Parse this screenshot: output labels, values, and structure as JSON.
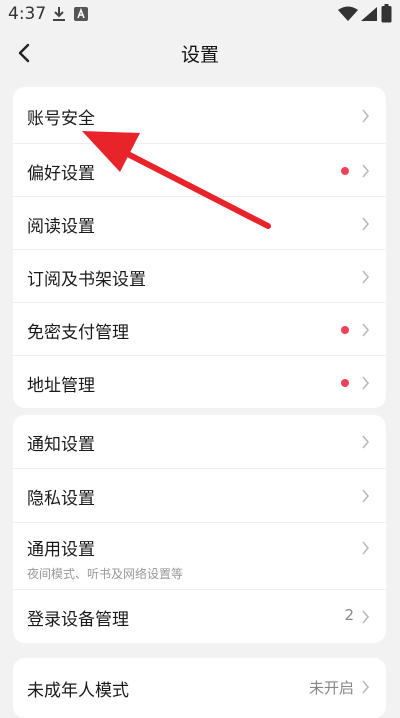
{
  "status_bar": {
    "time": "4:37",
    "icons": [
      "download-icon",
      "a-icon",
      "wifi-icon",
      "signal-icon",
      "battery-icon"
    ]
  },
  "nav": {
    "title": "设置",
    "back_icon": "back-arrow-icon"
  },
  "group1": {
    "items": [
      {
        "label": "账号安全",
        "red_dot": false
      },
      {
        "label": "偏好设置",
        "red_dot": true
      },
      {
        "label": "阅读设置",
        "red_dot": false
      },
      {
        "label": "订阅及书架设置",
        "red_dot": false
      },
      {
        "label": "免密支付管理",
        "red_dot": true
      },
      {
        "label": "地址管理",
        "red_dot": true
      }
    ]
  },
  "group2": {
    "items": [
      {
        "label": "通知设置"
      },
      {
        "label": "隐私设置"
      },
      {
        "label": "通用设置",
        "sub": "夜间模式、听书及网络设置等"
      },
      {
        "label": "登录设备管理",
        "value": "2"
      }
    ]
  },
  "group3": {
    "items": [
      {
        "label": "未成年人模式",
        "value": "未开启"
      }
    ]
  },
  "colors": {
    "background": "#f2f2f2",
    "card": "#ffffff",
    "red_dot": "#f0405a",
    "annotation_arrow": "#e8232a"
  }
}
